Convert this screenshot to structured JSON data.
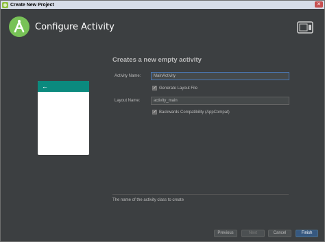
{
  "window": {
    "title": "Create New Project",
    "close_glyph": "✕"
  },
  "header": {
    "heading": "Configure Activity",
    "logo_icon": "android-studio-icon",
    "device_icon": "tablet-phone-icon"
  },
  "preview": {
    "back_glyph": "←",
    "appbar_color": "#0b8a7e"
  },
  "form": {
    "heading": "Creates a new empty activity",
    "activity_name_label": "Activity Name:",
    "activity_name_value": "MainActivity",
    "generate_layout_label": "Generate Layout File",
    "generate_layout_checked": true,
    "layout_name_label": "Layout Name:",
    "layout_name_value": "activity_main",
    "backwards_compat_label": "Backwards Compatibility (AppCompat)",
    "backwards_compat_checked": true,
    "check_glyph": "✓"
  },
  "hint": "The name of the activity class to create",
  "buttons": {
    "previous": "Previous",
    "next": "Next",
    "cancel": "Cancel",
    "finish": "Finish"
  },
  "colors": {
    "background": "#3c3f41",
    "primary_button": "#365880",
    "focus_border": "#4a78b5"
  }
}
